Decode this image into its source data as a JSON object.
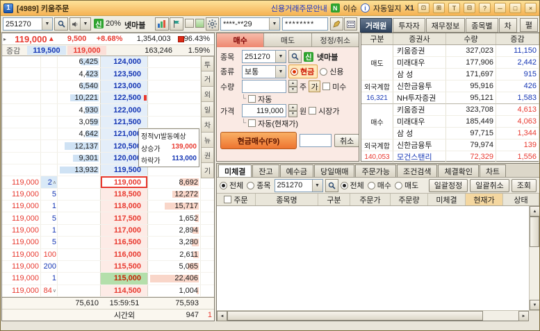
{
  "titlebar": {
    "app_icon": "1",
    "title": "[4989] 키움주문",
    "credit_link": "신용거래주문안내",
    "news_badge": "N",
    "news_label": "이슈",
    "diary_label": "자동일지",
    "x1_label": "X1",
    "help_label": "?",
    "min_label": "─",
    "max_label": "□",
    "close_label": "×"
  },
  "toolbar": {
    "stock_code": "251270",
    "credit_badge": "신",
    "percent_label": "20%",
    "stock_name": "넷마블",
    "account": "****-**29",
    "password": "********"
  },
  "right_tabs": {
    "items": [
      {
        "label": "거래원",
        "active": true
      },
      {
        "label": "투자자",
        "active": false
      },
      {
        "label": "재무정보",
        "active": false
      },
      {
        "label": "종목별",
        "active": false
      },
      {
        "label": "차",
        "active": false
      }
    ],
    "expand_label": "펼"
  },
  "quote": {
    "price": "119,000",
    "direction": "▲",
    "change": "9,500",
    "change_pct": "+8.68%",
    "volume": "1,354,003",
    "vol_ratio": "96.43%",
    "row2_label": "증감",
    "best_ask": "119,500",
    "best_bid": "119,000",
    "volume_prev": "163,246",
    "strength": "1.59%"
  },
  "orderbook": {
    "asks": [
      {
        "qty": "6,425",
        "price": "124,000"
      },
      {
        "qty": "4,423",
        "price": "123,500"
      },
      {
        "qty": "6,540",
        "price": "123,000"
      },
      {
        "qty": "10,221",
        "price": "122,500",
        "marker": true
      },
      {
        "qty": "4,930",
        "price": "122,000"
      },
      {
        "qty": "3,059",
        "price": "121,500"
      },
      {
        "qty": "4,642",
        "price": "121,000"
      },
      {
        "qty": "12,137",
        "price": "120,500"
      },
      {
        "qty": "9,301",
        "price": "120,000"
      },
      {
        "qty": "13,932",
        "price": "119,500"
      }
    ],
    "bids": [
      {
        "price": "119,000",
        "qty": "8,692",
        "current": true
      },
      {
        "price": "118,500",
        "qty": "12,272"
      },
      {
        "price": "118,000",
        "qty": "15,717"
      },
      {
        "price": "117,500",
        "qty": "1,652"
      },
      {
        "price": "117,000",
        "qty": "2,894"
      },
      {
        "price": "116,500",
        "qty": "3,280"
      },
      {
        "price": "116,000",
        "qty": "2,611"
      },
      {
        "price": "115,500",
        "qty": "5,065"
      },
      {
        "price": "115,000",
        "qty": "22,406",
        "highlight": true
      },
      {
        "price": "114,500",
        "qty": "1,004"
      }
    ],
    "ticks": [
      {
        "price": "119,000",
        "qty": "2",
        "side": "s",
        "arrow": "∧"
      },
      {
        "price": "119,000",
        "qty": "5",
        "side": "s"
      },
      {
        "price": "119,000",
        "qty": "1",
        "side": "s"
      },
      {
        "price": "119,000",
        "qty": "5",
        "side": "s"
      },
      {
        "price": "119,000",
        "qty": "1",
        "side": "s"
      },
      {
        "price": "119,000",
        "qty": "5",
        "side": "s"
      },
      {
        "price": "119,000",
        "qty": "100",
        "side": "b"
      },
      {
        "price": "119,000",
        "qty": "200",
        "side": "s"
      },
      {
        "price": "119,000",
        "qty": "1",
        "side": "s"
      },
      {
        "price": "119,000",
        "qty": "84",
        "side": "b",
        "arrow": "∨"
      }
    ],
    "vi_box": {
      "title": "정적VI발동예상",
      "up_label": "상승가",
      "up_price": "139,000",
      "down_label": "하락가",
      "down_price": "113,000"
    },
    "side_tabs": [
      "투",
      "거",
      "외",
      "일",
      "차",
      "뉴",
      "권",
      "기"
    ],
    "total_ask": "75,610",
    "time": "15:59:51",
    "total_bid": "75,593",
    "after_hours_label": "시간외",
    "after_hours_qty": "947",
    "after_hours_count": "1"
  },
  "order_entry": {
    "tabs": [
      {
        "label": "매수",
        "active": true
      },
      {
        "label": "매도",
        "active": false
      },
      {
        "label": "정정/취소",
        "active": false
      }
    ],
    "stock_label": "종목",
    "stock_code": "251270",
    "credit_badge": "신",
    "stock_name": "넷마블",
    "type_label": "종류",
    "type_value": "보통",
    "cash_label": "현금",
    "credit_label": "신용",
    "qty_label": "수량",
    "qty_value": "",
    "qty_unit": "주",
    "qty_btn": "가",
    "misu_label": "미수",
    "auto_label": "자동",
    "price_label": "가격",
    "price_value": "119,000",
    "price_unit": "원",
    "market_label": "시장가",
    "auto_cur_label": "자동(현재가)",
    "buy_button": "현금매수(F9)",
    "cancel_button": "취소"
  },
  "broker": {
    "headers": [
      "구분",
      "증권사",
      "수량",
      "증감"
    ],
    "sell_label": "매도",
    "buy_label": "매수",
    "foreign_label": "외국계합",
    "sell_foreign_total": "16,321",
    "buy_foreign_total": "140,053",
    "sell_rows": [
      {
        "name": "키움증권",
        "qty": "327,023",
        "chg": "11,150"
      },
      {
        "name": "미래대우",
        "qty": "177,906",
        "chg": "2,442"
      },
      {
        "name": "삼 성",
        "qty": "171,697",
        "chg": "915"
      },
      {
        "name": "신한금융투",
        "qty": "95,916",
        "chg": "426"
      },
      {
        "name": "NH투자증권",
        "qty": "95,121",
        "chg": "1,583"
      }
    ],
    "buy_rows": [
      {
        "name": "키움증권",
        "qty": "323,708",
        "chg": "4,613"
      },
      {
        "name": "미래대우",
        "qty": "185,449",
        "chg": "4,063"
      },
      {
        "name": "삼 성",
        "qty": "97,715",
        "chg": "1,344"
      },
      {
        "name": "신한금융투",
        "qty": "79,974",
        "chg": "139"
      },
      {
        "name": "모건스탠리",
        "qty": "72,329",
        "chg": "1,556",
        "foreign": true
      }
    ]
  },
  "pending": {
    "tabs": [
      {
        "label": "미체결",
        "active": true
      },
      {
        "label": "잔고",
        "active": false
      },
      {
        "label": "예수금",
        "active": false
      },
      {
        "label": "당일매매",
        "active": false
      },
      {
        "label": "주문가능",
        "active": false
      },
      {
        "label": "조건검색",
        "active": false
      },
      {
        "label": "체결확인",
        "active": false
      },
      {
        "label": "차트",
        "active": false
      }
    ],
    "filter": {
      "scope_all": "전체",
      "scope_stock": "종목",
      "stock_code": "251270",
      "side_all": "전체",
      "side_buy": "매수",
      "side_sell": "매도",
      "modify_all_btn": "일괄정정",
      "cancel_all_btn": "일괄취소",
      "query_btn": "조회"
    },
    "headers": [
      "주문",
      "종목명",
      "구분",
      "주문가",
      "주문량",
      "미체결",
      "현재가",
      "상태"
    ],
    "rows": []
  }
}
